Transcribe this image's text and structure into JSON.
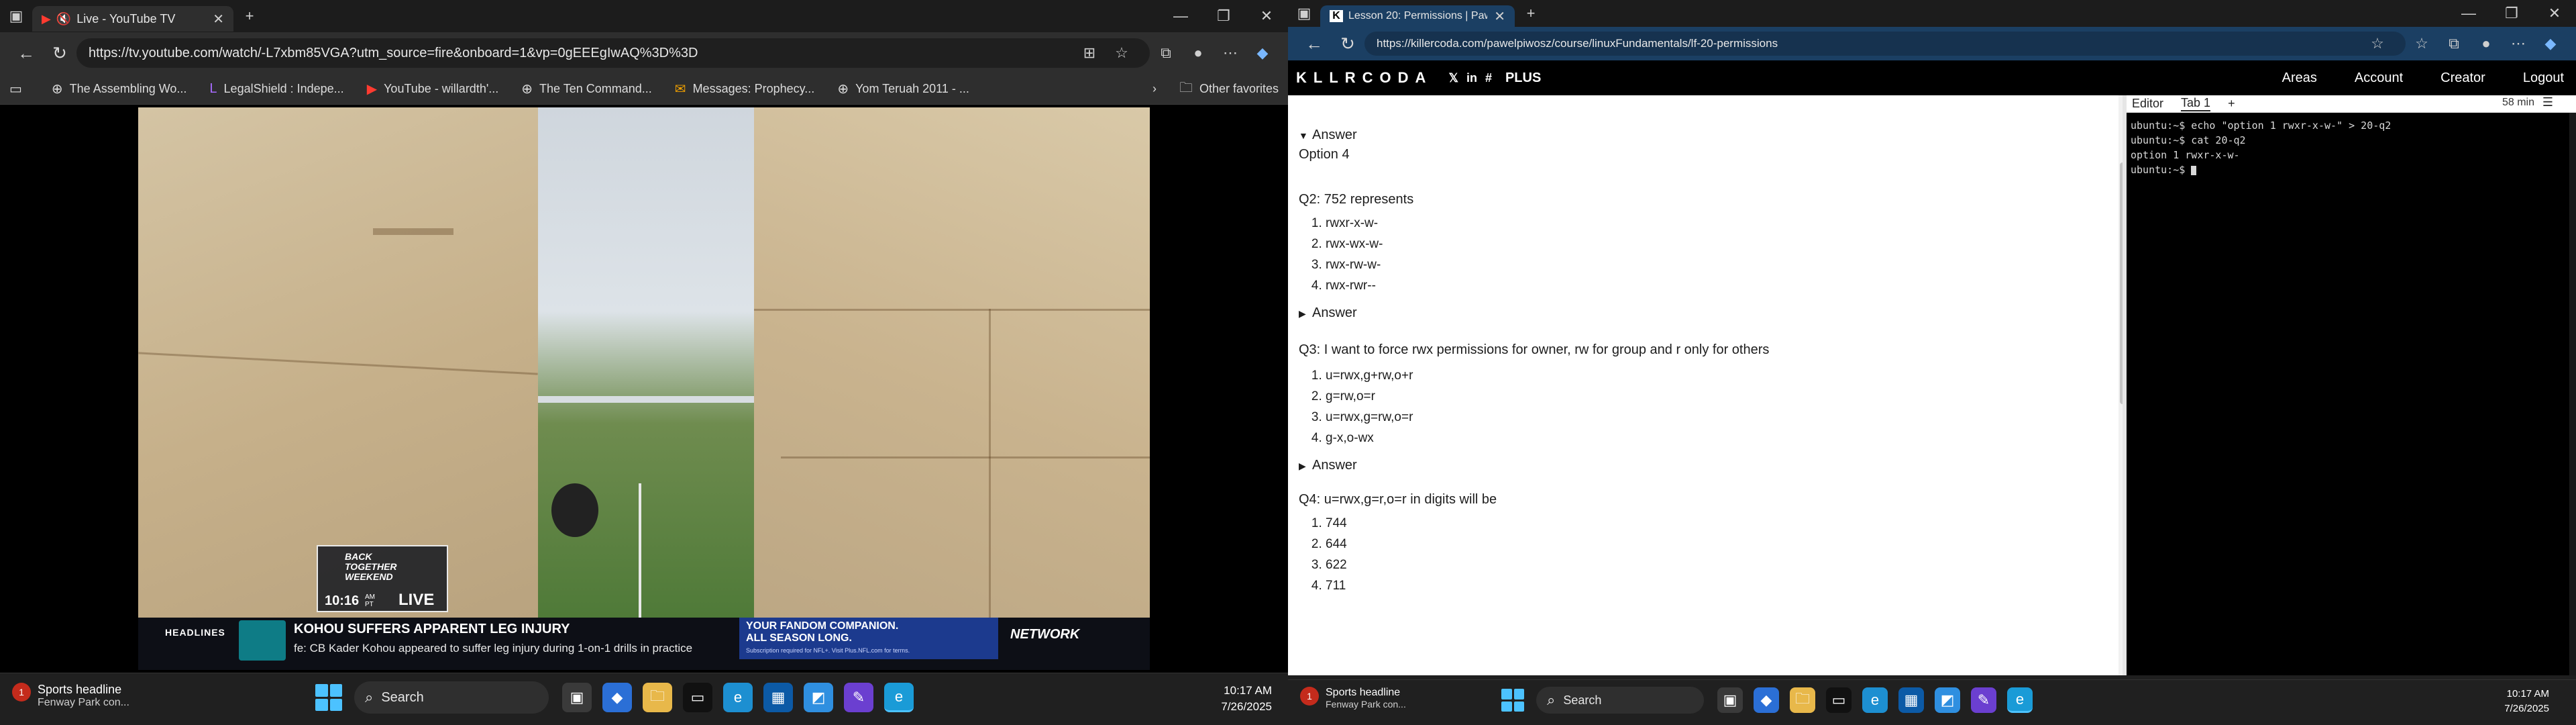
{
  "left": {
    "tab_title": "Live - YouTube TV",
    "url": "https://tv.youtube.com/watch/-L7xbm85VGA?utm_source=fire&onboard=1&vp=0gEEEgIwAQ%3D%3D",
    "bookmarks": [
      {
        "icon": "globe-icon",
        "label": "The Assembling Wo..."
      },
      {
        "icon": "legalshield-icon",
        "label": "LegalShield : Indepe..."
      },
      {
        "icon": "youtube-icon",
        "label": "YouTube - willardth'..."
      },
      {
        "icon": "globe-icon",
        "label": "The Ten Command..."
      },
      {
        "icon": "messages-icon",
        "label": "Messages: Prophecy..."
      },
      {
        "icon": "globe-icon",
        "label": "Yom Teruah 2011 - ..."
      }
    ],
    "other_favorites": "Other favorites",
    "video": {
      "badge_text": "BACK TOGETHER WEEKEND",
      "badge_time": "10:16",
      "badge_ampm": "AM PT",
      "badge_live": "LIVE",
      "headlines_label": "HEADLINES",
      "headline": "KOHOU SUFFERS APPARENT LEG INJURY",
      "subline": "fe: CB Kader Kohou appeared to suffer leg injury during 1-on-1 drills in practice",
      "ad_line1": "YOUR FANDOM COMPANION.",
      "ad_line2": "ALL SEASON LONG.",
      "ad_small": "Subscription required for NFL+. Visit Plus.NFL.com for terms.",
      "network": "NETWORK"
    },
    "taskbar": {
      "news_title": "Sports headline",
      "news_sub": "Fenway Park con...",
      "news_badge": "1",
      "search": "Search",
      "time": "10:17 AM",
      "date": "7/26/2025"
    }
  },
  "right": {
    "tab_title": "Lesson 20: Permissions | Pawel Pi...",
    "url": "https://killercoda.com/pawelpiwosz/course/linuxFundamentals/lf-20-permissions",
    "logo": "KLLRCODA",
    "plus": "PLUS",
    "nav": [
      "Areas",
      "Account",
      "Creator",
      "Logout"
    ],
    "content": {
      "answer_label": "Answer",
      "q1_answer": "Option 4",
      "q2": "Q2: 752 represents",
      "q2_options": [
        "rwxr-x-w-",
        "rwx-wx-w-",
        "rwx-rw-w-",
        "rwx-rwr--"
      ],
      "q3": "Q3: I want to force rwx permissions for owner, rw for group and r only for others",
      "q3_options": [
        "u=rwx,g+rw,o+r",
        "g=rw,o=r",
        "u=rwx,g=rw,o=r",
        "g-x,o-wx"
      ],
      "q4": "Q4: u=rwx,g=r,o=r in digits will be",
      "q4_options": [
        "744",
        "644",
        "622",
        "711"
      ]
    },
    "terminal": {
      "tabs": [
        "Editor",
        "Tab 1",
        "+"
      ],
      "timer": "58 min",
      "lines": [
        "ubuntu:~$ echo \"option 1 rwxr-x-w-\" > 20-q2",
        "ubuntu:~$ cat 20-q2",
        "option 1 rwxr-x-w-",
        "ubuntu:~$ "
      ]
    },
    "taskbar": {
      "news_title": "Sports headline",
      "news_sub": "Fenway Park con...",
      "news_badge": "1",
      "search": "Search",
      "time": "10:17 AM",
      "date": "7/26/2025"
    }
  }
}
